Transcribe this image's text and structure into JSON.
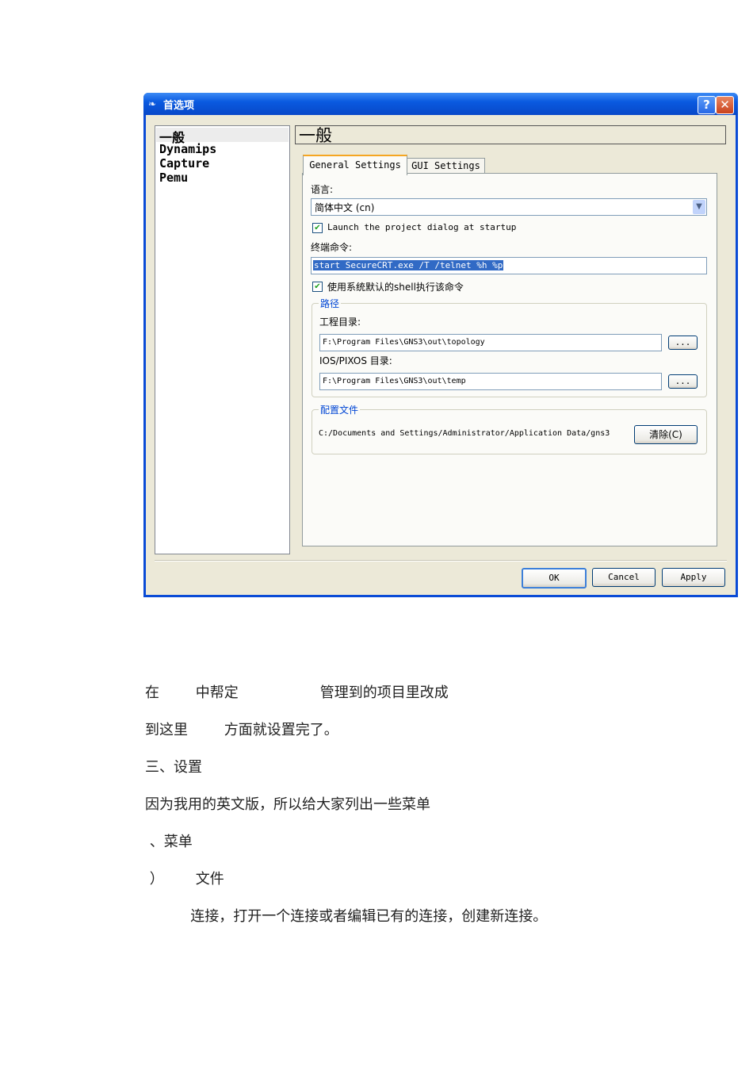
{
  "dialog": {
    "title": "首选项",
    "help_label": "?",
    "close_label": "✕",
    "nav_items": [
      "一般",
      "Dynamips",
      "Capture",
      "Pemu"
    ],
    "header": "一般",
    "tabs": [
      "General Settings",
      "GUI Settings"
    ],
    "language_label": "语言:",
    "language_value": "简体中文 (cn)",
    "launch_checkbox": "Launch the project dialog at startup",
    "terminal_label": "终端命令:",
    "terminal_value": "start SecureCRT.exe /T /telnet %h %p",
    "shell_checkbox": "使用系统默认的shell执行该命令",
    "paths_group": "路径",
    "project_dir_label": "工程目录:",
    "project_dir_value": "F:\\Program Files\\GNS3\\out\\topology",
    "ios_dir_label": "IOS/PIXOS 目录:",
    "ios_dir_value": "F:\\Program Files\\GNS3\\out\\temp",
    "browse_label": "...",
    "config_group": "配置文件",
    "config_path": "C:/Documents and Settings/Administrator/Application Data/gns3",
    "clear_label": "清除(C)",
    "ok_label": "OK",
    "cancel_label": "Cancel",
    "apply_label": "Apply"
  },
  "body": {
    "line1": "在        中帮定                  管理到的项目里改成",
    "line2": "到这里        方面就设置完了。",
    "line3": "三、设置",
    "line4": "因为我用的英文版，所以给大家列出一些菜单",
    "line5": " 、菜单",
    "line6": " ）       文件",
    "line7": "          连接，打开一个连接或者编辑已有的连接，创建新连接。"
  }
}
